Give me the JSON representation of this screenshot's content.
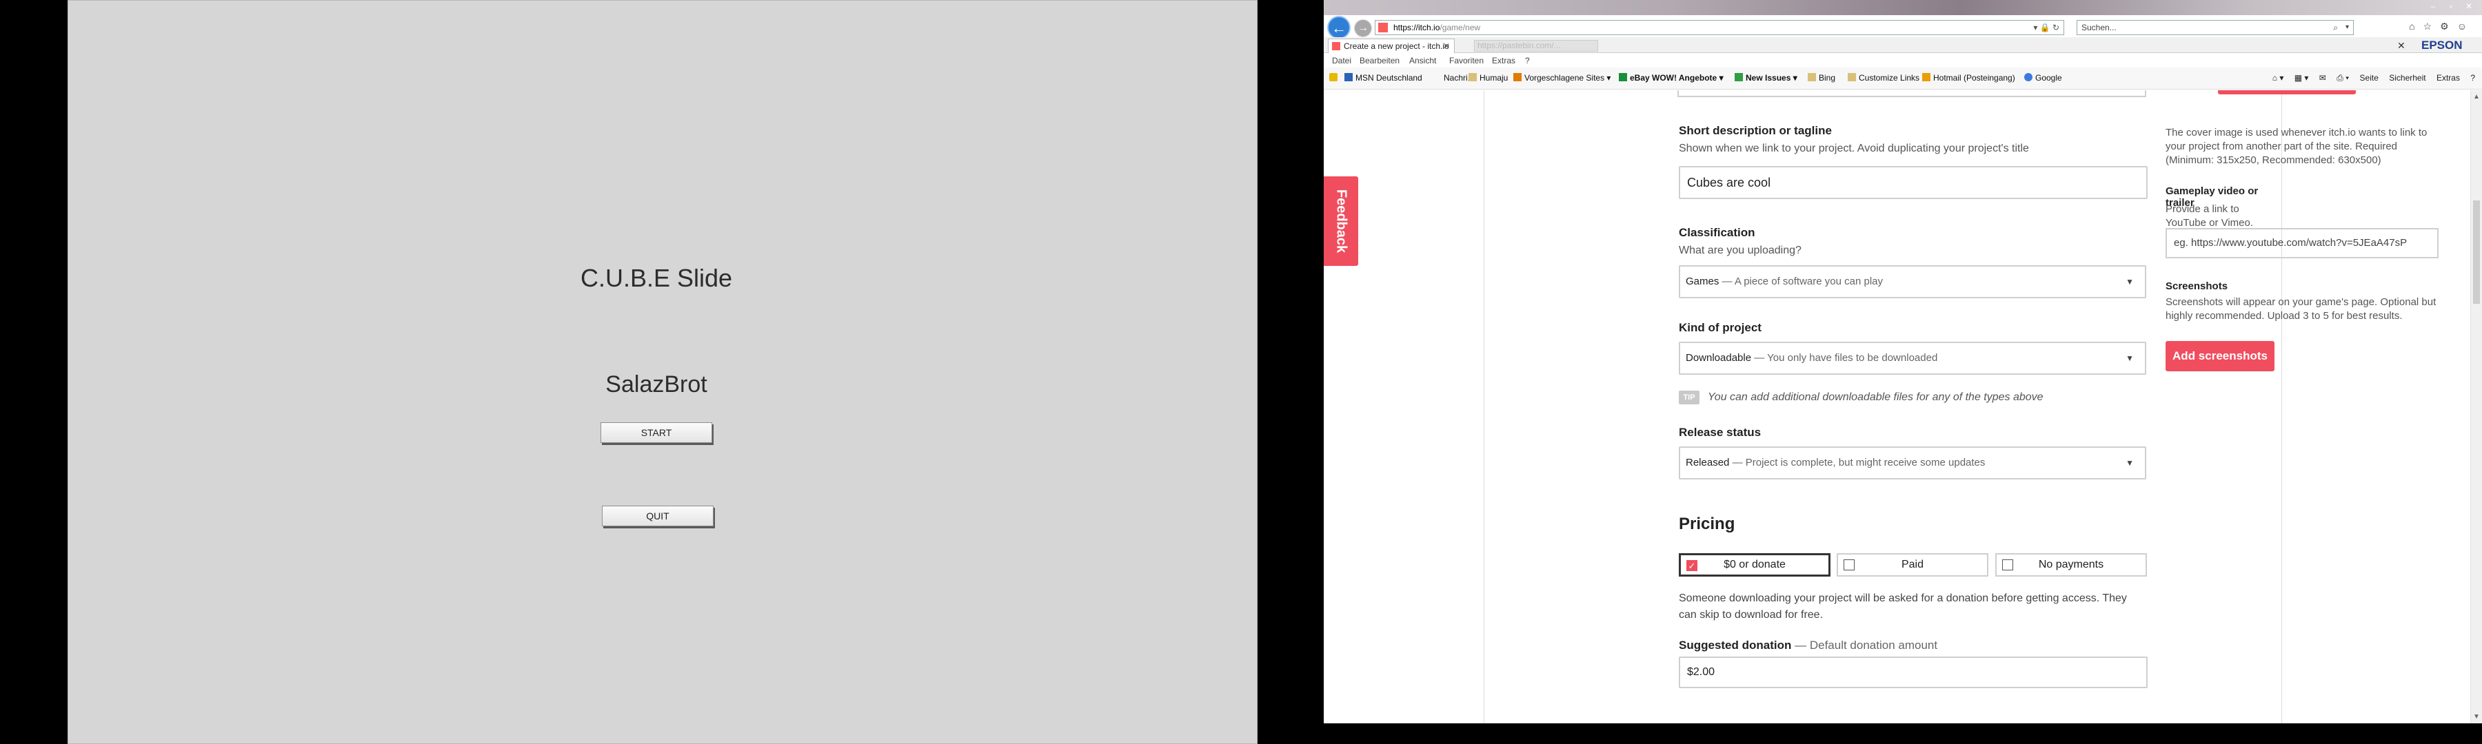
{
  "game": {
    "title": "C.U.B.E Slide",
    "author": "SalazBrot",
    "start_label": "START",
    "quit_label": "QUIT"
  },
  "browser": {
    "url_host": "https://itch.io",
    "url_path": "/game/new",
    "search_placeholder": "Suchen...",
    "active_tab": "Create a new project - itch.io",
    "ghost_tab": "https://pastebin.com/...",
    "brand": "EPSON",
    "menu": [
      "Datei",
      "Bearbeiten",
      "Ansicht",
      "Favoriten",
      "Extras",
      "?"
    ],
    "favorites": [
      "MSN Deutschland",
      "Nachri...",
      "Humaju",
      "Vorgeschlagene Sites",
      "eBay WOW! Angebote",
      "New Issues",
      "Bing",
      "Customize Links",
      "Hotmail (Posteingang)",
      "Google"
    ],
    "fav_tools": [
      "Seite",
      "Sicherheit",
      "Extras"
    ]
  },
  "form": {
    "feedback_label": "Feedback",
    "short_desc_label": "Short description or tagline",
    "short_desc_help": "Shown when we link to your project. Avoid duplicating your project's title",
    "short_desc_value": "Cubes are cool",
    "classification_label": "Classification",
    "classification_help": "What are you uploading?",
    "classification_value": "Games",
    "classification_hint": "— A piece of software you can play",
    "kind_label": "Kind of project",
    "kind_value": "Downloadable",
    "kind_hint": "— You only have files to be downloaded",
    "tip_badge": "TIP",
    "tip_text": "You can add additional downloadable files for any of the types above",
    "release_label": "Release status",
    "release_value": "Released",
    "release_hint": "— Project is complete, but might receive some updates",
    "pricing_title": "Pricing",
    "pricing_options": [
      "$0 or donate",
      "Paid",
      "No payments"
    ],
    "pricing_selected": "$0 or donate",
    "donate_note": "Someone downloading your project will be asked for a donation before getting access. They can skip to download for free.",
    "suggested_label": "Suggested donation",
    "suggested_hint": "— Default donation amount",
    "suggested_value": "$2.00"
  },
  "sidebar": {
    "cover_text": "The cover image is used whenever itch.io wants to link to your project from another part of the site. Required (Minimum: 315x250, Recommended: 630x500)",
    "video_label": "Gameplay video or trailer",
    "video_help": "Provide a link to YouTube or Vimeo.",
    "video_placeholder": "eg. https://www.youtube.com/watch?v=5JEaA47sP",
    "screens_label": "Screenshots",
    "screens_help": "Screenshots will appear on your game's page. Optional but highly recommended. Upload 3 to 5 for best results.",
    "add_screens_label": "Add screenshots"
  },
  "colors": {
    "accent": "#f04e5e",
    "game_bg": "#d6d6d6",
    "ie_blue": "#2f7fd6"
  }
}
